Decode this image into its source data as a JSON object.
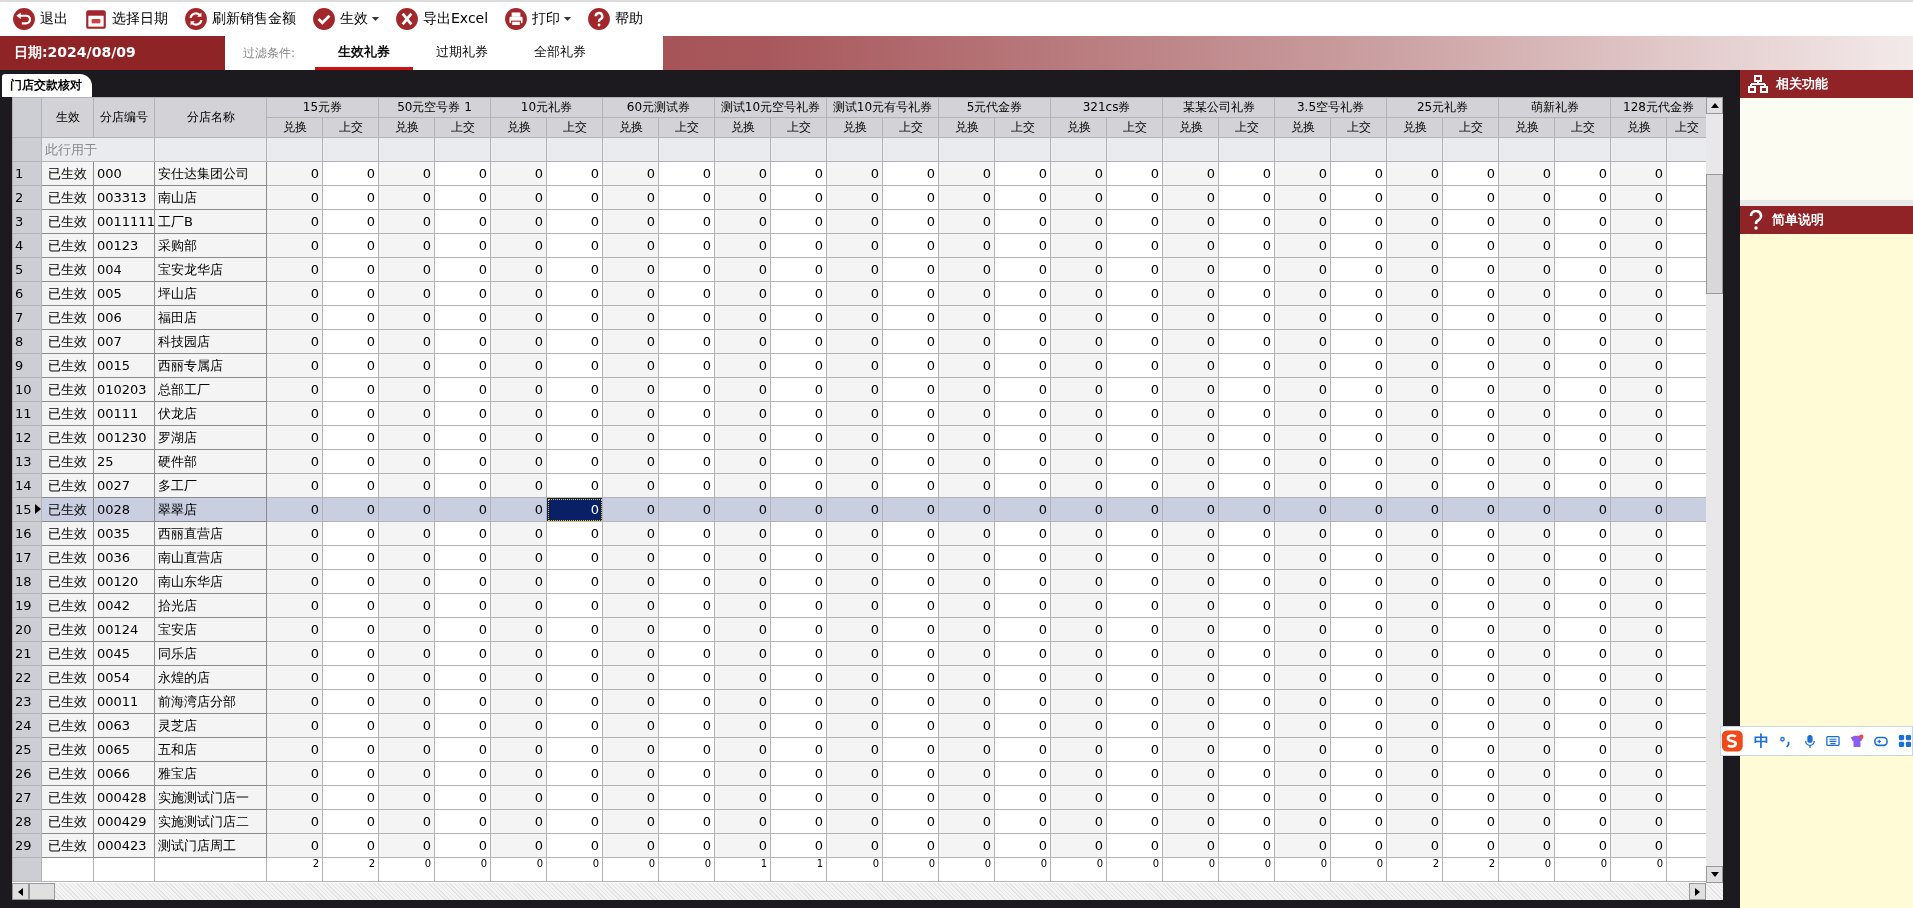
{
  "toolbar": [
    {
      "kind": "exit",
      "label": "退出",
      "dropdown": false
    },
    {
      "kind": "calendar",
      "label": "选择日期",
      "dropdown": false
    },
    {
      "kind": "refresh",
      "label": "刷新销售金额",
      "dropdown": false
    },
    {
      "kind": "check",
      "label": "生效",
      "dropdown": true
    },
    {
      "kind": "excel",
      "label": "导出Excel",
      "dropdown": false
    },
    {
      "kind": "print",
      "label": "打印",
      "dropdown": true
    },
    {
      "kind": "help",
      "label": "帮助",
      "dropdown": false
    }
  ],
  "date_label": "日期:2024/08/09",
  "filter": {
    "label": "过滤条件:",
    "tabs": [
      {
        "label": "生效礼券",
        "selected": true
      },
      {
        "label": "过期礼券",
        "selected": false
      },
      {
        "label": "全部礼券",
        "selected": false
      }
    ]
  },
  "panel_tab": "门店交款核对",
  "table": {
    "fixed_columns": [
      "生效",
      "分店编号",
      "分店名称"
    ],
    "groups": [
      {
        "title": "15元券",
        "subcolumns": [
          "兑换",
          "上交"
        ]
      },
      {
        "title": "50元空号券 1",
        "subcolumns": [
          "兑换",
          "上交"
        ]
      },
      {
        "title": "10元礼券",
        "subcolumns": [
          "兑换",
          "上交"
        ]
      },
      {
        "title": "60元测试券",
        "subcolumns": [
          "兑换",
          "上交"
        ]
      },
      {
        "title": "测试10元空号礼券",
        "subcolumns": [
          "兑换",
          "上交"
        ]
      },
      {
        "title": "测试10元有号礼券",
        "subcolumns": [
          "兑换",
          "上交"
        ]
      },
      {
        "title": "5元代金券",
        "subcolumns": [
          "兑换",
          "上交"
        ]
      },
      {
        "title": "321cs券",
        "subcolumns": [
          "兑换",
          "上交"
        ]
      },
      {
        "title": "某某公司礼券",
        "subcolumns": [
          "兑换",
          "上交"
        ]
      },
      {
        "title": "3.5空号礼券",
        "subcolumns": [
          "兑换",
          "上交"
        ]
      },
      {
        "title": "25元礼券",
        "subcolumns": [
          "兑换",
          "上交"
        ]
      },
      {
        "title": "萌新礼券",
        "subcolumns": [
          "兑换",
          "上交"
        ]
      },
      {
        "title": "128元代金券",
        "subcolumns": [
          "兑换",
          "上交"
        ]
      }
    ],
    "filter_row_text": "此行用于",
    "focused_columns": [
      false,
      false,
      false,
      false,
      false,
      true,
      false,
      false,
      false,
      false,
      false,
      false,
      false,
      false,
      false,
      false,
      false,
      false,
      false,
      false,
      false,
      false,
      false,
      false,
      false
    ],
    "rows": [
      {
        "num": "1",
        "status": "已生效",
        "code": "000",
        "name": "安仕达集团公司",
        "selected": false,
        "values": [
          "0",
          "0",
          "0",
          "0",
          "0",
          "0",
          "0",
          "0",
          "0",
          "0",
          "0",
          "0",
          "0",
          "0",
          "0",
          "0",
          "0",
          "0",
          "0",
          "0",
          "0",
          "0",
          "0",
          "0",
          "0"
        ]
      },
      {
        "num": "2",
        "status": "已生效",
        "code": "003313",
        "name": "南山店",
        "selected": false,
        "values": [
          "0",
          "0",
          "0",
          "0",
          "0",
          "0",
          "0",
          "0",
          "0",
          "0",
          "0",
          "0",
          "0",
          "0",
          "0",
          "0",
          "0",
          "0",
          "0",
          "0",
          "0",
          "0",
          "0",
          "0",
          "0"
        ]
      },
      {
        "num": "3",
        "status": "已生效",
        "code": "0011111",
        "name": "工厂B",
        "selected": false,
        "values": [
          "0",
          "0",
          "0",
          "0",
          "0",
          "0",
          "0",
          "0",
          "0",
          "0",
          "0",
          "0",
          "0",
          "0",
          "0",
          "0",
          "0",
          "0",
          "0",
          "0",
          "0",
          "0",
          "0",
          "0",
          "0"
        ]
      },
      {
        "num": "4",
        "status": "已生效",
        "code": "00123",
        "name": "采购部",
        "selected": false,
        "values": [
          "0",
          "0",
          "0",
          "0",
          "0",
          "0",
          "0",
          "0",
          "0",
          "0",
          "0",
          "0",
          "0",
          "0",
          "0",
          "0",
          "0",
          "0",
          "0",
          "0",
          "0",
          "0",
          "0",
          "0",
          "0"
        ]
      },
      {
        "num": "5",
        "status": "已生效",
        "code": "004",
        "name": "宝安龙华店",
        "selected": false,
        "values": [
          "0",
          "0",
          "0",
          "0",
          "0",
          "0",
          "0",
          "0",
          "0",
          "0",
          "0",
          "0",
          "0",
          "0",
          "0",
          "0",
          "0",
          "0",
          "0",
          "0",
          "0",
          "0",
          "0",
          "0",
          "0"
        ]
      },
      {
        "num": "6",
        "status": "已生效",
        "code": "005",
        "name": "坪山店",
        "selected": false,
        "values": [
          "0",
          "0",
          "0",
          "0",
          "0",
          "0",
          "0",
          "0",
          "0",
          "0",
          "0",
          "0",
          "0",
          "0",
          "0",
          "0",
          "0",
          "0",
          "0",
          "0",
          "0",
          "0",
          "0",
          "0",
          "0"
        ]
      },
      {
        "num": "7",
        "status": "已生效",
        "code": "006",
        "name": "福田店",
        "selected": false,
        "values": [
          "0",
          "0",
          "0",
          "0",
          "0",
          "0",
          "0",
          "0",
          "0",
          "0",
          "0",
          "0",
          "0",
          "0",
          "0",
          "0",
          "0",
          "0",
          "0",
          "0",
          "0",
          "0",
          "0",
          "0",
          "0"
        ]
      },
      {
        "num": "8",
        "status": "已生效",
        "code": "007",
        "name": "科技园店",
        "selected": false,
        "values": [
          "0",
          "0",
          "0",
          "0",
          "0",
          "0",
          "0",
          "0",
          "0",
          "0",
          "0",
          "0",
          "0",
          "0",
          "0",
          "0",
          "0",
          "0",
          "0",
          "0",
          "0",
          "0",
          "0",
          "0",
          "0"
        ]
      },
      {
        "num": "9",
        "status": "已生效",
        "code": "0015",
        "name": "西丽专属店",
        "selected": false,
        "values": [
          "0",
          "0",
          "0",
          "0",
          "0",
          "0",
          "0",
          "0",
          "0",
          "0",
          "0",
          "0",
          "0",
          "0",
          "0",
          "0",
          "0",
          "0",
          "0",
          "0",
          "0",
          "0",
          "0",
          "0",
          "0"
        ]
      },
      {
        "num": "10",
        "status": "已生效",
        "code": "010203",
        "name": "总部工厂",
        "selected": false,
        "values": [
          "0",
          "0",
          "0",
          "0",
          "0",
          "0",
          "0",
          "0",
          "0",
          "0",
          "0",
          "0",
          "0",
          "0",
          "0",
          "0",
          "0",
          "0",
          "0",
          "0",
          "0",
          "0",
          "0",
          "0",
          "0"
        ]
      },
      {
        "num": "11",
        "status": "已生效",
        "code": "00111",
        "name": "伏龙店",
        "selected": false,
        "values": [
          "0",
          "0",
          "0",
          "0",
          "0",
          "0",
          "0",
          "0",
          "0",
          "0",
          "0",
          "0",
          "0",
          "0",
          "0",
          "0",
          "0",
          "0",
          "0",
          "0",
          "0",
          "0",
          "0",
          "0",
          "0"
        ]
      },
      {
        "num": "12",
        "status": "已生效",
        "code": "001230",
        "name": "罗湖店",
        "selected": false,
        "values": [
          "0",
          "0",
          "0",
          "0",
          "0",
          "0",
          "0",
          "0",
          "0",
          "0",
          "0",
          "0",
          "0",
          "0",
          "0",
          "0",
          "0",
          "0",
          "0",
          "0",
          "0",
          "0",
          "0",
          "0",
          "0"
        ]
      },
      {
        "num": "13",
        "status": "已生效",
        "code": "25",
        "name": "硬件部",
        "selected": false,
        "values": [
          "0",
          "0",
          "0",
          "0",
          "0",
          "0",
          "0",
          "0",
          "0",
          "0",
          "0",
          "0",
          "0",
          "0",
          "0",
          "0",
          "0",
          "0",
          "0",
          "0",
          "0",
          "0",
          "0",
          "0",
          "0"
        ]
      },
      {
        "num": "14",
        "status": "已生效",
        "code": "0027",
        "name": "多工厂",
        "selected": false,
        "values": [
          "0",
          "0",
          "0",
          "0",
          "0",
          "0",
          "0",
          "0",
          "0",
          "0",
          "0",
          "0",
          "0",
          "0",
          "0",
          "0",
          "0",
          "0",
          "0",
          "0",
          "0",
          "0",
          "0",
          "0",
          "0"
        ]
      },
      {
        "num": "15",
        "status": "已生效",
        "code": "0028",
        "name": "翠翠店",
        "selected": true,
        "values": [
          "0",
          "0",
          "0",
          "0",
          "0",
          "0",
          "0",
          "0",
          "0",
          "0",
          "0",
          "0",
          "0",
          "0",
          "0",
          "0",
          "0",
          "0",
          "0",
          "0",
          "0",
          "0",
          "0",
          "0",
          "0"
        ]
      },
      {
        "num": "16",
        "status": "已生效",
        "code": "0035",
        "name": "西丽直营店",
        "selected": false,
        "values": [
          "0",
          "0",
          "0",
          "0",
          "0",
          "0",
          "0",
          "0",
          "0",
          "0",
          "0",
          "0",
          "0",
          "0",
          "0",
          "0",
          "0",
          "0",
          "0",
          "0",
          "0",
          "0",
          "0",
          "0",
          "0"
        ]
      },
      {
        "num": "17",
        "status": "已生效",
        "code": "0036",
        "name": "南山直营店",
        "selected": false,
        "values": [
          "0",
          "0",
          "0",
          "0",
          "0",
          "0",
          "0",
          "0",
          "0",
          "0",
          "0",
          "0",
          "0",
          "0",
          "0",
          "0",
          "0",
          "0",
          "0",
          "0",
          "0",
          "0",
          "0",
          "0",
          "0"
        ]
      },
      {
        "num": "18",
        "status": "已生效",
        "code": "00120",
        "name": "南山东华店",
        "selected": false,
        "values": [
          "0",
          "0",
          "0",
          "0",
          "0",
          "0",
          "0",
          "0",
          "0",
          "0",
          "0",
          "0",
          "0",
          "0",
          "0",
          "0",
          "0",
          "0",
          "0",
          "0",
          "0",
          "0",
          "0",
          "0",
          "0"
        ]
      },
      {
        "num": "19",
        "status": "已生效",
        "code": "0042",
        "name": "拾光店",
        "selected": false,
        "values": [
          "0",
          "0",
          "0",
          "0",
          "0",
          "0",
          "0",
          "0",
          "0",
          "0",
          "0",
          "0",
          "0",
          "0",
          "0",
          "0",
          "0",
          "0",
          "0",
          "0",
          "0",
          "0",
          "0",
          "0",
          "0"
        ]
      },
      {
        "num": "20",
        "status": "已生效",
        "code": "00124",
        "name": "宝安店",
        "selected": false,
        "values": [
          "0",
          "0",
          "0",
          "0",
          "0",
          "0",
          "0",
          "0",
          "0",
          "0",
          "0",
          "0",
          "0",
          "0",
          "0",
          "0",
          "0",
          "0",
          "0",
          "0",
          "0",
          "0",
          "0",
          "0",
          "0"
        ]
      },
      {
        "num": "21",
        "status": "已生效",
        "code": "0045",
        "name": "同乐店",
        "selected": false,
        "values": [
          "0",
          "0",
          "0",
          "0",
          "0",
          "0",
          "0",
          "0",
          "0",
          "0",
          "0",
          "0",
          "0",
          "0",
          "0",
          "0",
          "0",
          "0",
          "0",
          "0",
          "0",
          "0",
          "0",
          "0",
          "0"
        ]
      },
      {
        "num": "22",
        "status": "已生效",
        "code": "0054",
        "name": "永煌的店",
        "selected": false,
        "values": [
          "0",
          "0",
          "0",
          "0",
          "0",
          "0",
          "0",
          "0",
          "0",
          "0",
          "0",
          "0",
          "0",
          "0",
          "0",
          "0",
          "0",
          "0",
          "0",
          "0",
          "0",
          "0",
          "0",
          "0",
          "0"
        ]
      },
      {
        "num": "23",
        "status": "已生效",
        "code": "00011",
        "name": "前海湾店分部",
        "selected": false,
        "values": [
          "0",
          "0",
          "0",
          "0",
          "0",
          "0",
          "0",
          "0",
          "0",
          "0",
          "0",
          "0",
          "0",
          "0",
          "0",
          "0",
          "0",
          "0",
          "0",
          "0",
          "0",
          "0",
          "0",
          "0",
          "0"
        ]
      },
      {
        "num": "24",
        "status": "已生效",
        "code": "0063",
        "name": "灵芝店",
        "selected": false,
        "values": [
          "0",
          "0",
          "0",
          "0",
          "0",
          "0",
          "0",
          "0",
          "0",
          "0",
          "0",
          "0",
          "0",
          "0",
          "0",
          "0",
          "0",
          "0",
          "0",
          "0",
          "0",
          "0",
          "0",
          "0",
          "0"
        ]
      },
      {
        "num": "25",
        "status": "已生效",
        "code": "0065",
        "name": "五和店",
        "selected": false,
        "values": [
          "0",
          "0",
          "0",
          "0",
          "0",
          "0",
          "0",
          "0",
          "0",
          "0",
          "0",
          "0",
          "0",
          "0",
          "0",
          "0",
          "0",
          "0",
          "0",
          "0",
          "0",
          "0",
          "0",
          "0",
          "0"
        ]
      },
      {
        "num": "26",
        "status": "已生效",
        "code": "0066",
        "name": "雅宝店",
        "selected": false,
        "values": [
          "0",
          "0",
          "0",
          "0",
          "0",
          "0",
          "0",
          "0",
          "0",
          "0",
          "0",
          "0",
          "0",
          "0",
          "0",
          "0",
          "0",
          "0",
          "0",
          "0",
          "0",
          "0",
          "0",
          "0",
          "0"
        ]
      },
      {
        "num": "27",
        "status": "已生效",
        "code": "000428",
        "name": "实施测试门店一",
        "selected": false,
        "values": [
          "0",
          "0",
          "0",
          "0",
          "0",
          "0",
          "0",
          "0",
          "0",
          "0",
          "0",
          "0",
          "0",
          "0",
          "0",
          "0",
          "0",
          "0",
          "0",
          "0",
          "0",
          "0",
          "0",
          "0",
          "0"
        ]
      },
      {
        "num": "28",
        "status": "已生效",
        "code": "000429",
        "name": "实施测试门店二",
        "selected": false,
        "values": [
          "0",
          "0",
          "0",
          "0",
          "0",
          "0",
          "0",
          "0",
          "0",
          "0",
          "0",
          "0",
          "0",
          "0",
          "0",
          "0",
          "0",
          "0",
          "0",
          "0",
          "0",
          "0",
          "0",
          "0",
          "0"
        ]
      },
      {
        "num": "29",
        "status": "已生效",
        "code": "000423",
        "name": "测试门店周工",
        "selected": false,
        "values": [
          "0",
          "0",
          "0",
          "0",
          "0",
          "0",
          "0",
          "0",
          "0",
          "0",
          "0",
          "0",
          "0",
          "0",
          "0",
          "0",
          "0",
          "0",
          "0",
          "0",
          "0",
          "0",
          "0",
          "0",
          "0"
        ]
      }
    ],
    "totals": [
      "2",
      "2",
      "0",
      "0",
      "0",
      "0",
      "0",
      "0",
      "1",
      "1",
      "0",
      "0",
      "0",
      "0",
      "0",
      "0",
      "0",
      "0",
      "0",
      "0",
      "2",
      "2",
      "0",
      "0",
      "0"
    ]
  },
  "side_panels": [
    {
      "kind": "functions",
      "title": "相关功能"
    },
    {
      "kind": "help",
      "title": "简单说明"
    }
  ],
  "ime_bar": {
    "mode": "中"
  }
}
